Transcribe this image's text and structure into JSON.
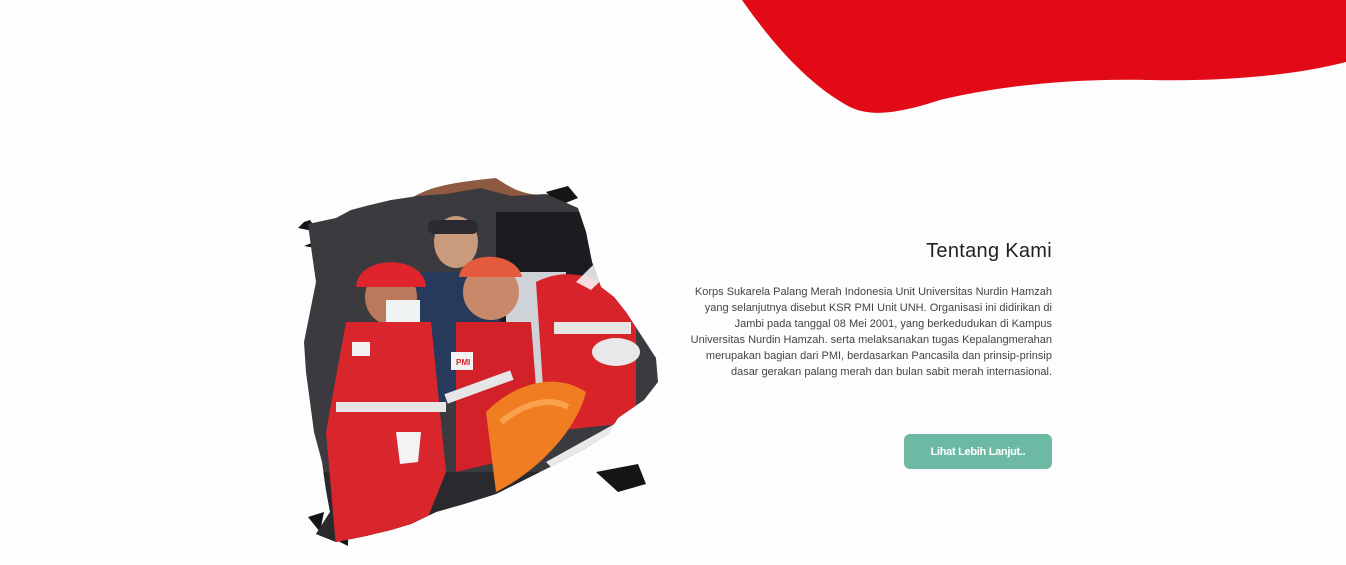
{
  "colors": {
    "background": "#fdfdfd",
    "brand_red": "#e20a17",
    "button_green": "#6dbaa4",
    "title_text": "#222222",
    "body_text": "#444444"
  },
  "about": {
    "title": "Tentang Kami",
    "description": "Korps Sukarela Palang Merah Indonesia Unit Universitas Nurdin Hamzah yang selanjutnya disebut KSR PMI Unit UNH. Organisasi ini didirikan di Jambi pada tanggal 08 Mei 2001, yang berkedudukan di Kampus Universitas Nurdin Hamzah. serta melaksanakan tugas Kepalangmerahan merupakan bagian dari PMI, berdasarkan Pancasila dan prinsip-prinsip dasar gerakan palang merah dan bulan sabit merah internasional.",
    "button_label": "Lihat Lebih Lanjut.."
  },
  "photo": {
    "subject": "PMI volunteers in red uniforms and helmets carrying a stretcher",
    "badge_text": "PMI"
  }
}
